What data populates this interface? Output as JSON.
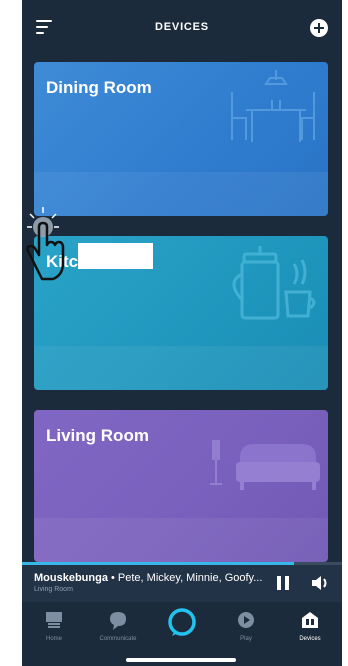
{
  "header": {
    "title": "DEVICES"
  },
  "rooms": [
    {
      "name": "Dining Room",
      "color": "#3080d0"
    },
    {
      "name": "Kitch",
      "color": "#1f98c0"
    },
    {
      "name": "Living Room",
      "color": "#7a60bd"
    }
  ],
  "player": {
    "track": "Mouskebunga",
    "separator": " • ",
    "artists": "Pete, Mickey, Minnie, Goofy...",
    "device": "Living Room",
    "progress": 0.85
  },
  "nav": {
    "items": [
      {
        "label": "Home",
        "icon": "home-icon"
      },
      {
        "label": "Communicate",
        "icon": "chat-bubble-icon"
      },
      {
        "label": "",
        "icon": "alexa-ring-icon"
      },
      {
        "label": "Play",
        "icon": "play-icon"
      },
      {
        "label": "Devices",
        "icon": "devices-icon"
      }
    ],
    "active": "Devices"
  },
  "colors": {
    "background": "#1c2b3c",
    "accent": "#38b8e8"
  }
}
